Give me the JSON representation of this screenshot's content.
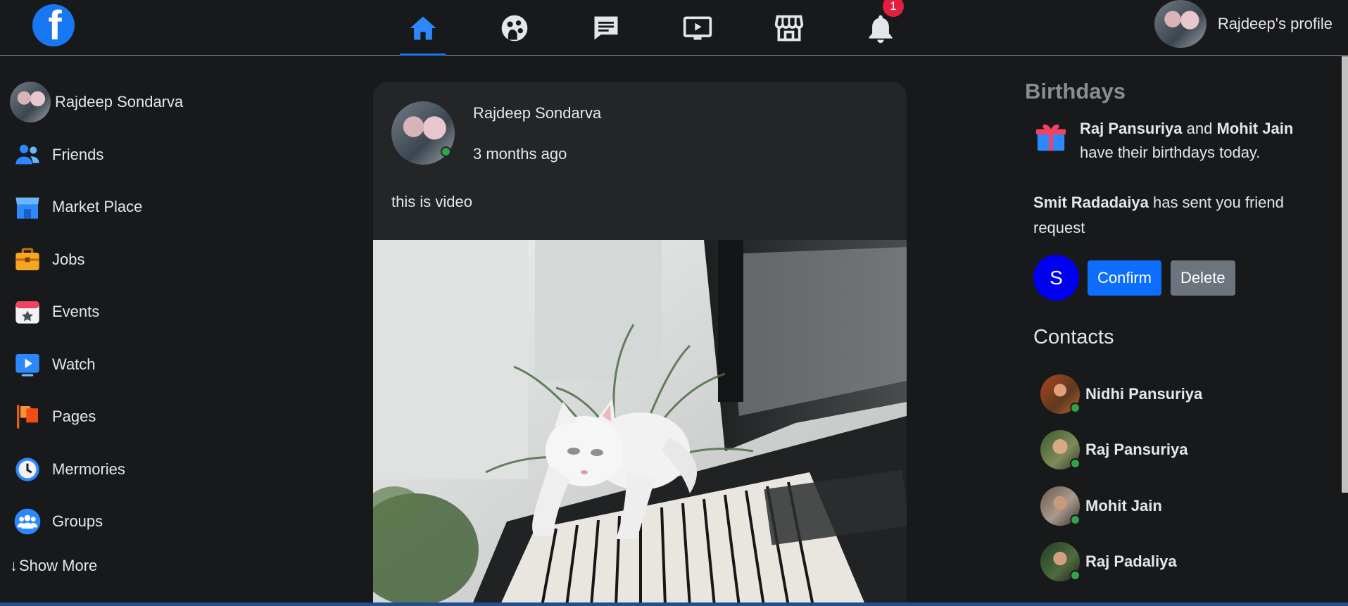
{
  "topbar": {
    "logo": "f",
    "nav": [
      {
        "name": "home",
        "icon": "home-icon"
      },
      {
        "name": "groups",
        "icon": "groups-icon"
      },
      {
        "name": "messages",
        "icon": "message-icon"
      },
      {
        "name": "watch",
        "icon": "video-icon"
      },
      {
        "name": "marketplace",
        "icon": "store-icon"
      },
      {
        "name": "notifications",
        "icon": "bell-icon"
      }
    ],
    "notification_count": "1",
    "profile_label": "Rajdeep's profile"
  },
  "sidebar": {
    "user_name": "Rajdeep Sondarva",
    "items": [
      {
        "label": "Friends",
        "icon": "friends-icon"
      },
      {
        "label": "Market Place",
        "icon": "marketplace-icon"
      },
      {
        "label": "Jobs",
        "icon": "jobs-icon"
      },
      {
        "label": "Events",
        "icon": "events-icon"
      },
      {
        "label": "Watch",
        "icon": "watch-icon"
      },
      {
        "label": "Pages",
        "icon": "pages-icon"
      },
      {
        "label": "Mermories",
        "icon": "memories-icon"
      },
      {
        "label": "Groups",
        "icon": "groups-icon"
      }
    ],
    "show_more": "Show More"
  },
  "post": {
    "author": "Rajdeep Sondarva",
    "time": "3 months ago",
    "text": "this is video"
  },
  "right": {
    "birthdays_title": "Birthdays",
    "birthday": {
      "person1": "Raj Pansuriya",
      "and": "and",
      "person2": "Mohit Jain",
      "rest": "have their birthdays today."
    },
    "friend_request": {
      "name": "Smit Radadaiya",
      "text": "has sent you friend request",
      "avatar_letter": "S",
      "confirm": "Confirm",
      "delete": "Delete"
    },
    "contacts_title": "Contacts",
    "contacts": [
      {
        "name": "Nidhi Pansuriya"
      },
      {
        "name": "Raj Pansuriya"
      },
      {
        "name": "Mohit Jain"
      },
      {
        "name": "Raj Padaliya"
      }
    ]
  },
  "colors": {
    "background": "#18191a",
    "card": "#242526",
    "accent": "#1877f2",
    "online": "#31a24c",
    "badge": "#e41e3f"
  }
}
